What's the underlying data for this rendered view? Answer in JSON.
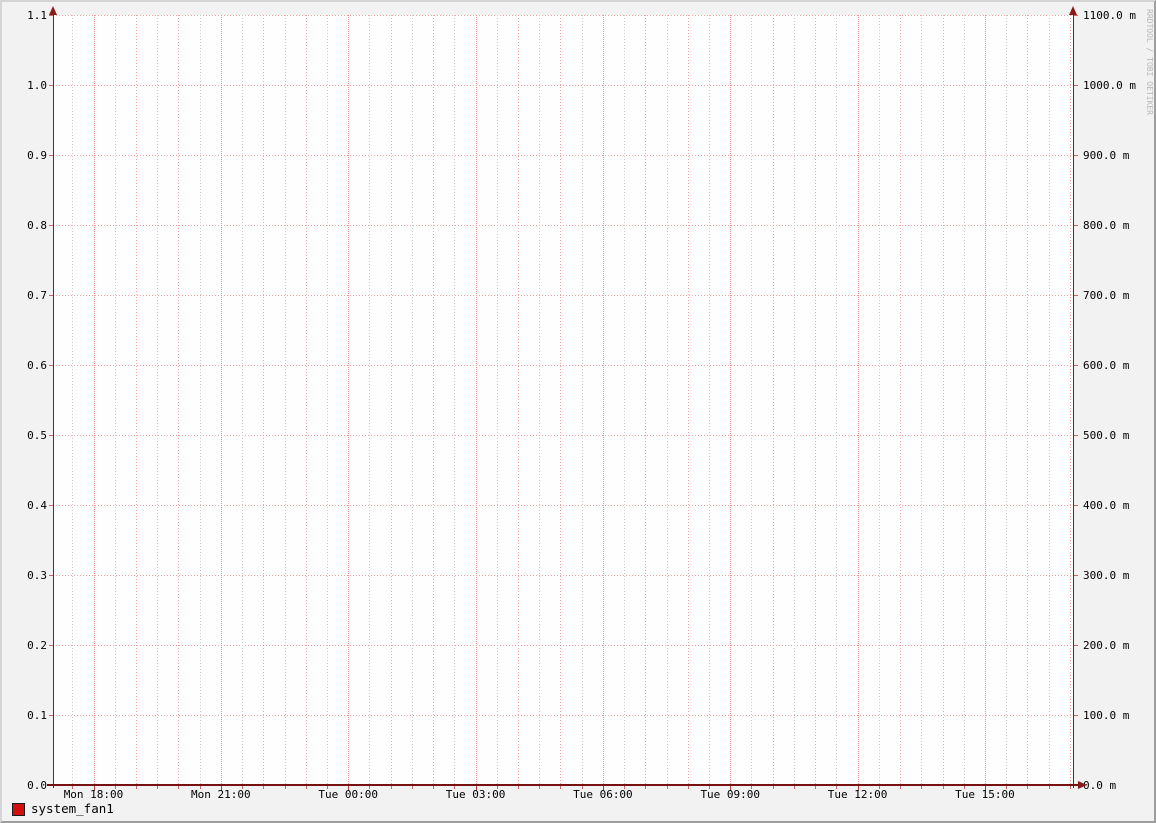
{
  "chart_data": {
    "type": "line",
    "title": "",
    "watermark": "RRDTOOL / TOBI OETIKER",
    "x_axis": {
      "tick_labels": [
        "Mon 18:00",
        "Mon 21:00",
        "Tue 00:00",
        "Tue 03:00",
        "Tue 06:00",
        "Tue 09:00",
        "Tue 12:00",
        "Tue 15:00"
      ],
      "label_interval": "3 hours",
      "major_grid_interval": "1 hour",
      "minor_grid_interval": "30 minutes"
    },
    "y_axis_left": {
      "tick_labels": [
        "0.0",
        "0.1",
        "0.2",
        "0.3",
        "0.4",
        "0.5",
        "0.6",
        "0.7",
        "0.8",
        "0.9",
        "1.0",
        "1.1"
      ],
      "range": [
        0.0,
        1.1
      ]
    },
    "y_axis_right": {
      "tick_labels": [
        "0.0 m",
        "100.0 m",
        "200.0 m",
        "300.0 m",
        "400.0 m",
        "500.0 m",
        "600.0 m",
        "700.0 m",
        "800.0 m",
        "900.0 m",
        "1000.0 m",
        "1100.0 m"
      ],
      "range_milli": [
        0,
        1100
      ]
    },
    "series": [
      {
        "name": "system_fan1",
        "color": "#d01010",
        "categories": [
          "Mon 18:00",
          "Mon 21:00",
          "Tue 00:00",
          "Tue 03:00",
          "Tue 06:00",
          "Tue 09:00",
          "Tue 12:00",
          "Tue 15:00"
        ],
        "values": [
          0,
          0,
          0,
          0,
          0,
          0,
          0,
          0
        ]
      }
    ],
    "legend": [
      {
        "label": "system_fan1",
        "swatch_color": "#d01010"
      }
    ],
    "grid": true,
    "legend_position": "bottom-left"
  },
  "colors": {
    "background": "#f2f2f2",
    "canvas": "#fefefe",
    "grid_minor": "#cbcbcb",
    "grid_hour": "#f0a6a6",
    "grid_major": "#e78f8f",
    "axis": "#3a3a3a",
    "x_axis_line": "#771111",
    "arrow": "#8a1c18",
    "legend_swatch": "#d01010",
    "watermark_text": "#b9b9b9"
  }
}
